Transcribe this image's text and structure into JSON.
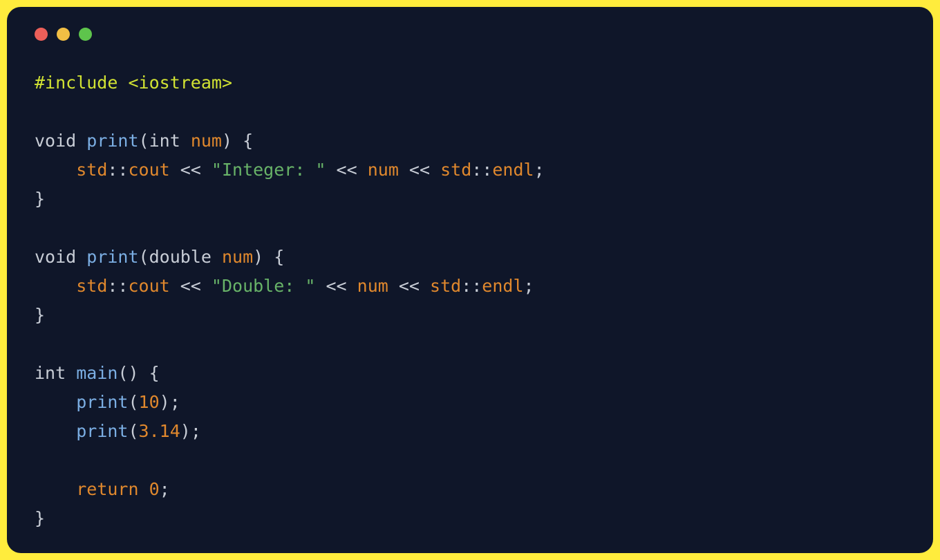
{
  "code": {
    "tokens": {
      "include_directive": "#include",
      "include_header": "<iostream>",
      "void1": "void",
      "print1": "print",
      "lparen1": "(",
      "int_kw1": "int",
      "space": " ",
      "num_param1": "num",
      "rparen1": ")",
      "lbrace1": " {",
      "indent": "    ",
      "std1": "std",
      "scope1": "::",
      "cout1": "cout",
      "shl1": " << ",
      "str_int": "\"Integer: \"",
      "shl2": " << ",
      "num_ref1": "num",
      "shl3": " << ",
      "std2": "std",
      "scope2": "::",
      "endl1": "endl",
      "semi1": ";",
      "rbrace1": "}",
      "void2": "void",
      "print2": "print",
      "lparen2": "(",
      "double_kw": "double",
      "num_param2": "num",
      "rparen2": ")",
      "lbrace2": " {",
      "std3": "std",
      "scope3": "::",
      "cout2": "cout",
      "shl4": " << ",
      "str_dbl": "\"Double: \"",
      "shl5": " << ",
      "num_ref2": "num",
      "shl6": " << ",
      "std4": "std",
      "scope4": "::",
      "endl2": "endl",
      "semi2": ";",
      "rbrace2": "}",
      "int_kw2": "int",
      "main_fn": "main",
      "lparen3": "(",
      "rparen3": ")",
      "lbrace3": " {",
      "print_call1": "print",
      "lparen4": "(",
      "ten": "10",
      "rparen4": ")",
      "semi3": ";",
      "print_call2": "print",
      "lparen5": "(",
      "pi": "3.14",
      "rparen5": ")",
      "semi4": ";",
      "return_kw": "return",
      "zero": "0",
      "semi5": ";",
      "rbrace3": "}"
    }
  }
}
